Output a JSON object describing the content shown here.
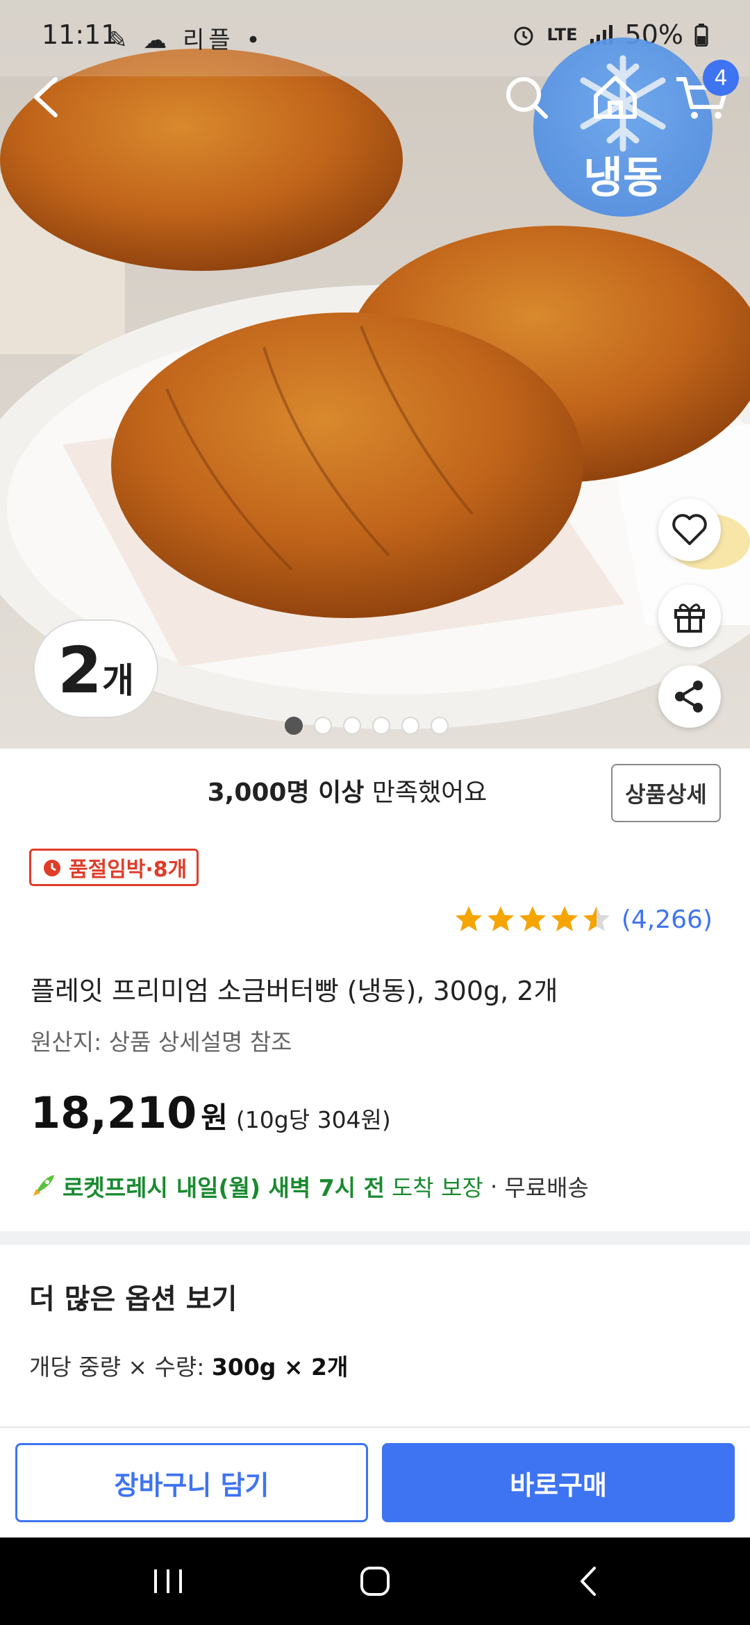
{
  "status_bar": {
    "time": "11:11",
    "left_icons": "✎ ☁ 리플 •",
    "network": "LTE",
    "battery": "50%"
  },
  "header": {
    "cart_count": "4",
    "frozen_label": "냉동"
  },
  "hero": {
    "quantity_number": "2",
    "quantity_unit": "개",
    "image_count": 6,
    "active_image_index": 0
  },
  "summary": {
    "satisfaction_strong": "3,000명 이상",
    "satisfaction_rest": " 만족했어요",
    "detail_button": "상품상세"
  },
  "product": {
    "soldout_badge": "품절임박·8개",
    "rating": 4.5,
    "review_count": "(4,266)",
    "title": "플레잇 프리미엄 소금버터빵 (냉동), 300g, 2개",
    "origin": "원산지: 상품 상세설명 참조",
    "price": "18,210",
    "price_unit": "원",
    "unit_price": "(10g당 304원)",
    "delivery_brand": "로켓프레시",
    "delivery_time": "내일(월) 새벽 7시 전",
    "delivery_guarantee": "도착 보장",
    "delivery_separator": "·",
    "delivery_free": "무료배송"
  },
  "options": {
    "title": "더 많은 옵션 보기",
    "label": "개당 중량 × 수량: ",
    "value": "300g × 2개"
  },
  "actions": {
    "add_to_cart": "장바구니 담기",
    "buy_now": "바로구매"
  },
  "colors": {
    "accent": "#3e74f2",
    "alert": "#e03c28",
    "delivery": "#1a8a30"
  }
}
